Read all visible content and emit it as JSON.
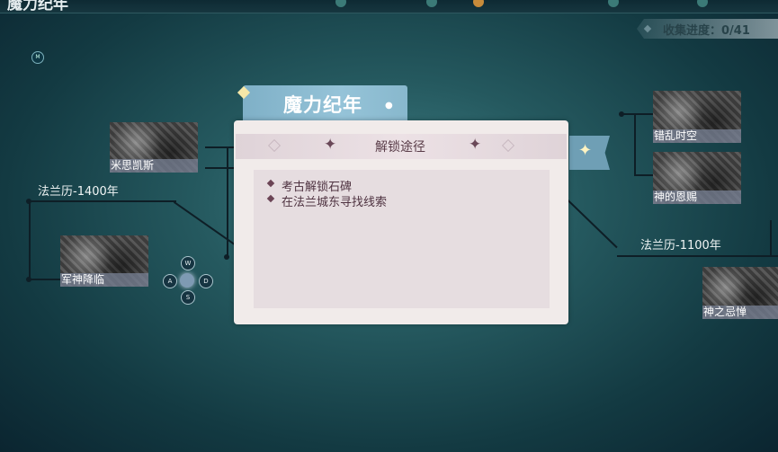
{
  "header": {
    "title": "魔力纪年"
  },
  "progress": {
    "label": "收集进度：0/41"
  },
  "map_badge": "M",
  "eras": {
    "left": "法兰历-1400年",
    "right": "法兰历-1100年"
  },
  "nodes": {
    "misikaisi": "米思凯斯",
    "junshen": "军神降临",
    "cuoluan": "错乱时空",
    "shenen": "神的恩赐",
    "shenji": "神之忌惮"
  },
  "controls": {
    "up": "W",
    "left": "A",
    "right": "D",
    "down": "S"
  },
  "card": {
    "ribbon_title": "魔力纪年",
    "panel_title": "解锁途径",
    "methods": [
      "考古解锁石碑",
      "在法兰城东寻找线索"
    ]
  }
}
